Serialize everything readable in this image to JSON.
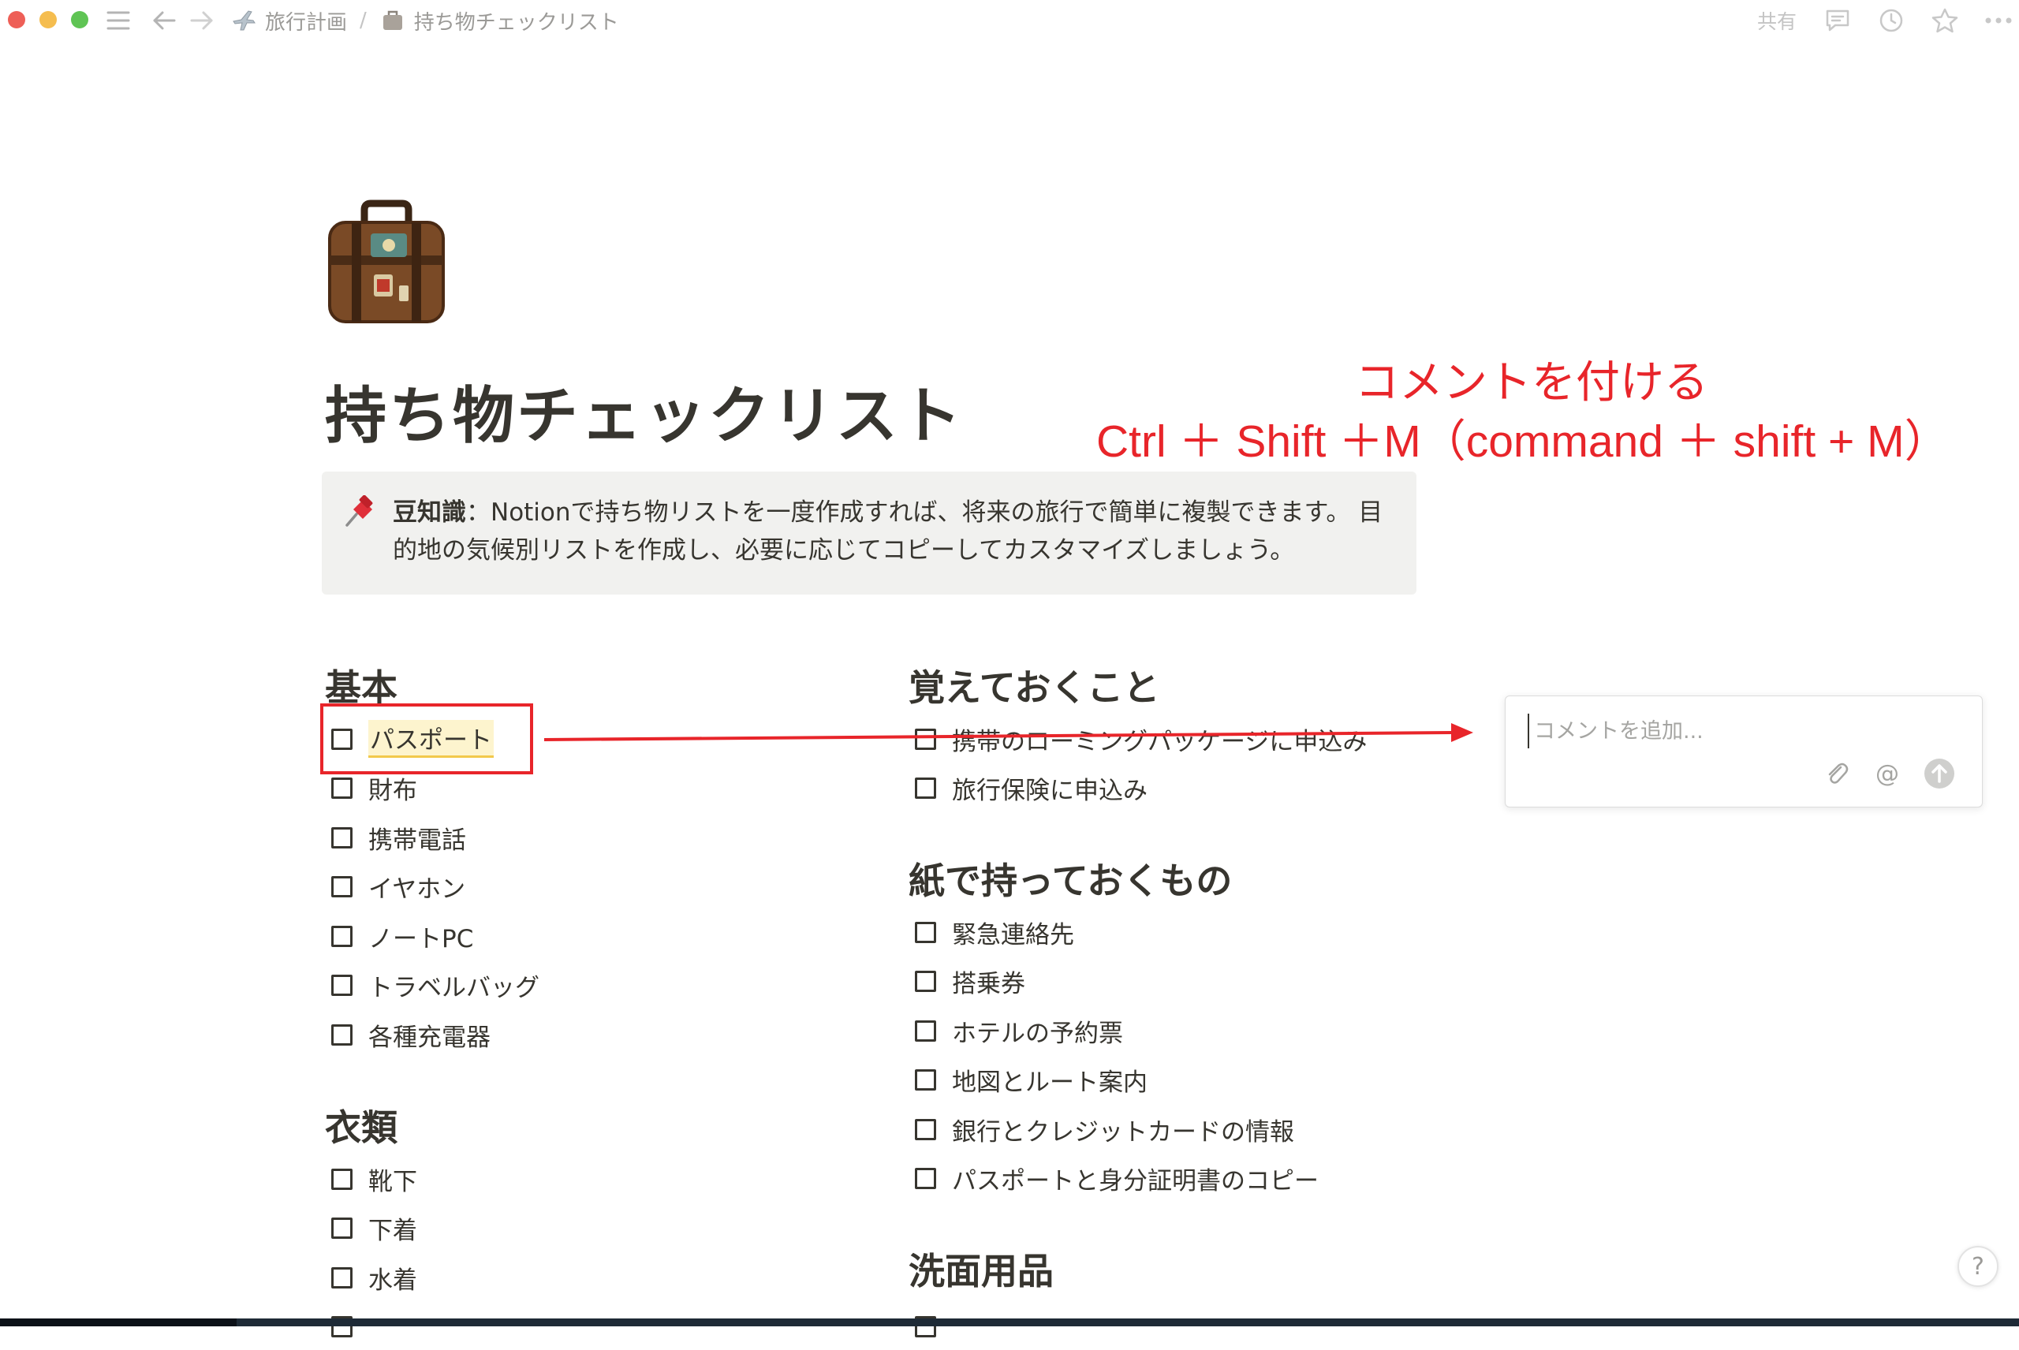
{
  "breadcrumb": {
    "parent": "旅行計画",
    "current": "持ち物チェックリスト"
  },
  "topbar": {
    "share_label": "共有"
  },
  "page": {
    "title": "持ち物チェックリスト"
  },
  "annotation": {
    "line1": "コメントを付ける",
    "line2": "Ctrl ＋ Shift ＋M（command ＋ shift + M）"
  },
  "callout": {
    "bold": "豆知識",
    "text": "：Notionで持ち物リストを一度作成すれば、将来の旅行で簡単に複製できます。 目的地の気候別リストを作成し、必要に応じてコピーしてカスタマイズしましょう。"
  },
  "sections": {
    "basic": {
      "title": "基本",
      "items": [
        "パスポート",
        "財布",
        "携帯電話",
        "イヤホン",
        "ノートPC",
        "トラベルバッグ",
        "各種充電器"
      ]
    },
    "clothing": {
      "title": "衣類",
      "items": [
        "靴下",
        "下着",
        "水着"
      ]
    },
    "remember": {
      "title": "覚えておくこと",
      "items": [
        "携帯のローミングパッケージに申込み",
        "旅行保険に申込み"
      ]
    },
    "paper": {
      "title": "紙で持っておくもの",
      "items": [
        "緊急連絡先",
        "搭乗券",
        "ホテルの予約票",
        "地図とルート案内",
        "銀行とクレジットカードの情報",
        "パスポートと身分証明書のコピー"
      ]
    },
    "toiletries": {
      "title": "洗面用品"
    }
  },
  "comment": {
    "placeholder": "コメントを追加..."
  },
  "help": {
    "label": "?"
  },
  "colors": {
    "annotation_red": "#e8252a",
    "text": "#37352f",
    "callout_bg": "#f1f1ef",
    "highlight": "#fdf4ce"
  }
}
